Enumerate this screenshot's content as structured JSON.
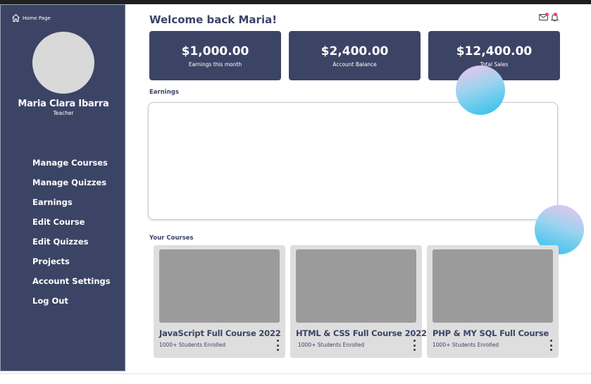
{
  "sidebar": {
    "home_label": "Home Page",
    "user_name": "Maria Clara Ibarra",
    "user_role": "Teacher",
    "nav": [
      "Manage Courses",
      "Manage Quizzes",
      "Earnings",
      "Edit Course",
      "Edit Quizzes",
      "Projects",
      "Account Settings",
      "Log Out"
    ]
  },
  "header": {
    "welcome_prefix": "Welcome back ",
    "welcome_name": "Maria!",
    "icons": [
      "mail-icon",
      "bell-icon"
    ]
  },
  "stats": [
    {
      "amount": "$1,000.00",
      "label": "Earnings this month"
    },
    {
      "amount": "$2,400.00",
      "label": "Account Balance"
    },
    {
      "amount": "$12,400.00",
      "label": "Total Sales"
    }
  ],
  "earnings": {
    "title": "Earnings"
  },
  "courses": {
    "title": "Your Courses",
    "items": [
      {
        "title": "JavaScript Full  Course 2022",
        "enrolled": "1000+ Students Enrolled"
      },
      {
        "title": "HTML & CSS Full Course 2022",
        "enrolled": "1000+ Students Enrolled"
      },
      {
        "title": "PHP & MY SQL Full Course",
        "enrolled": "1000+ Students Enrolled"
      }
    ]
  },
  "colors": {
    "sidebar_bg": "#3c4465",
    "card_bg": "#3c4465",
    "course_card_bg": "#dedede",
    "thumb": "#9b9b9b",
    "notification_dot": "#e8437a"
  }
}
